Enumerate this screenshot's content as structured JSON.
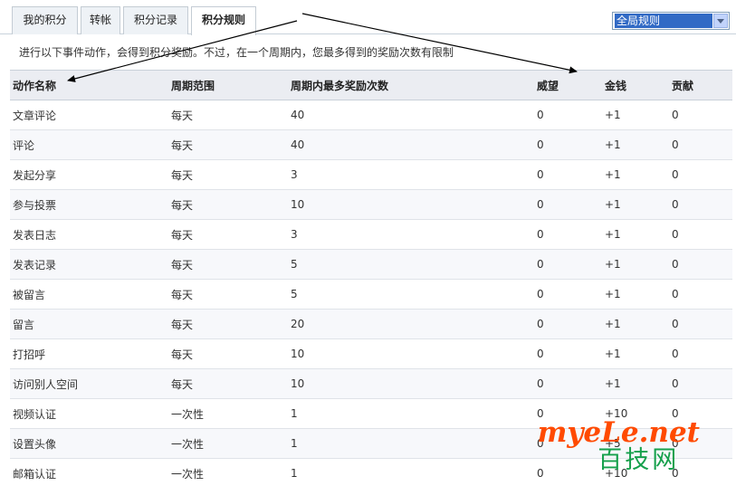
{
  "tabs": [
    {
      "label": "我的积分",
      "active": false
    },
    {
      "label": "转帐",
      "active": false
    },
    {
      "label": "积分记录",
      "active": false
    },
    {
      "label": "积分规则",
      "active": true
    }
  ],
  "filter_select": {
    "selected": "全局规则"
  },
  "notice": "进行以下事件动作，会得到积分奖励。不过，在一个周期内，您最多得到的奖励次数有限制",
  "table": {
    "headers": [
      "动作名称",
      "周期范围",
      "周期内最多奖励次数",
      "威望",
      "金钱",
      "贡献"
    ],
    "rows": [
      [
        "文章评论",
        "每天",
        "40",
        "0",
        "+1",
        "0"
      ],
      [
        "评论",
        "每天",
        "40",
        "0",
        "+1",
        "0"
      ],
      [
        "发起分享",
        "每天",
        "3",
        "0",
        "+1",
        "0"
      ],
      [
        "参与投票",
        "每天",
        "10",
        "0",
        "+1",
        "0"
      ],
      [
        "发表日志",
        "每天",
        "3",
        "0",
        "+1",
        "0"
      ],
      [
        "发表记录",
        "每天",
        "5",
        "0",
        "+1",
        "0"
      ],
      [
        "被留言",
        "每天",
        "5",
        "0",
        "+1",
        "0"
      ],
      [
        "留言",
        "每天",
        "20",
        "0",
        "+1",
        "0"
      ],
      [
        "打招呼",
        "每天",
        "10",
        "0",
        "+1",
        "0"
      ],
      [
        "访问别人空间",
        "每天",
        "10",
        "0",
        "+1",
        "0"
      ],
      [
        "视频认证",
        "一次性",
        "1",
        "0",
        "+10",
        "0"
      ],
      [
        "设置头像",
        "一次性",
        "1",
        "0",
        "+5",
        "0"
      ],
      [
        "邮箱认证",
        "一次性",
        "1",
        "0",
        "+10",
        "0"
      ]
    ]
  },
  "watermark": {
    "line1": "myeLe.net",
    "line2": "百技网"
  }
}
